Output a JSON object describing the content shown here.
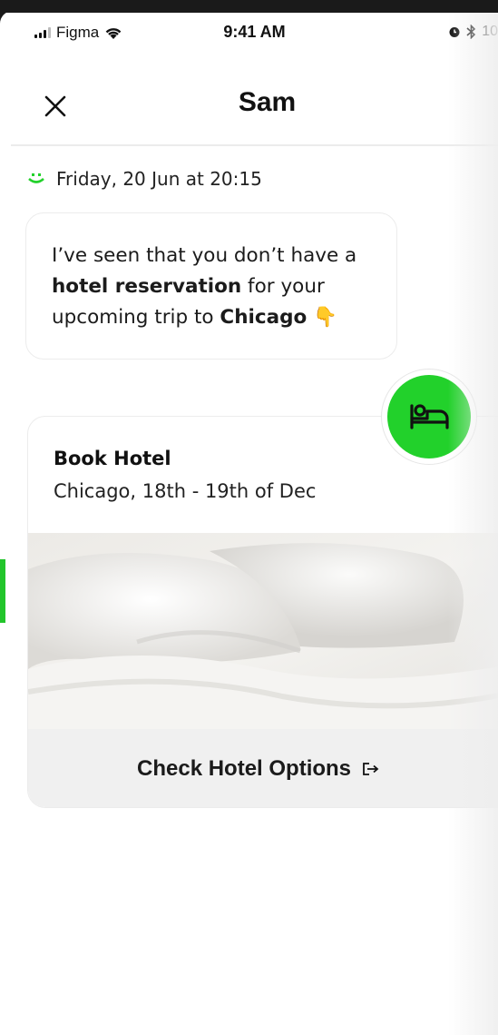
{
  "status_bar": {
    "carrier": "Figma",
    "time": "9:41 AM",
    "battery": "10"
  },
  "header": {
    "title": "Sam"
  },
  "chat": {
    "date": "Friday, 20 Jun at 20:15",
    "message": {
      "part1": "I’ve seen that you don’t have a ",
      "bold1": "hotel reservation",
      "part2": " for your upcoming trip to ",
      "bold2": "Chicago",
      "emoji": "👇"
    }
  },
  "card": {
    "title": "Book Hotel",
    "subtitle": "Chicago, 18th - 19th of Dec",
    "cta_label": "Check Hotel Options"
  },
  "icons": {
    "close": "close-icon",
    "bot": "bot-face-icon",
    "bed": "bed-icon",
    "external": "exit-arrow-icon",
    "signal": "signal-icon",
    "wifi": "wifi-icon",
    "alarm": "alarm-icon",
    "bluetooth": "bluetooth-icon"
  },
  "colors": {
    "accent_green": "#22d12b",
    "text": "#111111"
  }
}
